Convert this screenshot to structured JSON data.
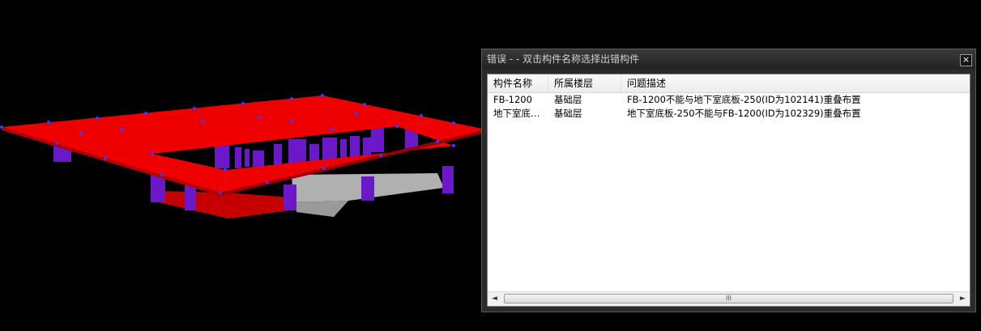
{
  "dialog": {
    "title": "错误 - - 双击构件名称选择出错构件",
    "close_label": "×",
    "columns": [
      "构件名称",
      "所属楼层",
      "问题描述"
    ],
    "rows": [
      {
        "name": "FB-1200",
        "floor": "基础层",
        "desc": "FB-1200不能与地下室底板-250(ID为102141)重叠布置"
      },
      {
        "name": "地下室底…",
        "floor": "基础层",
        "desc": "地下室底板-250不能与FB-1200(ID为102329)重叠布置"
      }
    ],
    "scroll_left": "◄",
    "scroll_right": "►",
    "scroll_grip": "III"
  }
}
